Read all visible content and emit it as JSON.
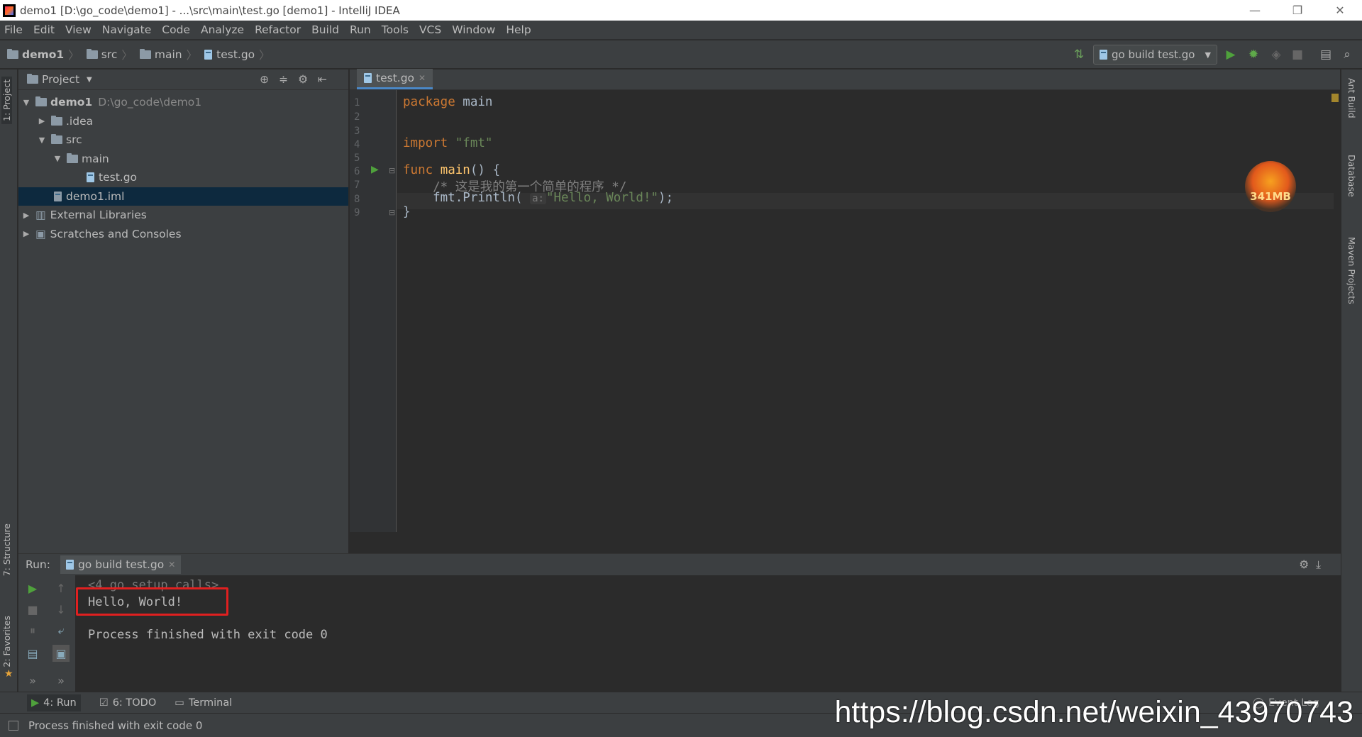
{
  "window": {
    "title": "demo1 [D:\\go_code\\demo1] - ...\\src\\main\\test.go [demo1] - IntelliJ IDEA"
  },
  "menu": [
    "File",
    "Edit",
    "View",
    "Navigate",
    "Code",
    "Analyze",
    "Refactor",
    "Build",
    "Run",
    "Tools",
    "VCS",
    "Window",
    "Help"
  ],
  "breadcrumbs": [
    "demo1",
    "src",
    "main",
    "test.go"
  ],
  "run_config": "go build test.go",
  "project": {
    "header": "Project",
    "tree": [
      {
        "label": "demo1",
        "extra": "D:\\go_code\\demo1"
      },
      {
        "label": ".idea"
      },
      {
        "label": "src"
      },
      {
        "label": "main"
      },
      {
        "label": "test.go"
      },
      {
        "label": "demo1.iml"
      },
      {
        "label": "External Libraries"
      },
      {
        "label": "Scratches and Consoles"
      }
    ]
  },
  "editor": {
    "tab": "test.go",
    "line_numbers": [
      "1",
      "2",
      "3",
      "4",
      "5",
      "6",
      "7",
      "8",
      "9"
    ],
    "code": {
      "l1_kw": "package",
      "l1_rest": " main",
      "l4_kw": "import",
      "l4_str": "\"fmt\"",
      "l6_kw": "func",
      "l6_fn": "main",
      "l6_rest": "() {",
      "l7": "    /* 这是我的第一个简单的程序 */",
      "l8_a": "    fmt.Println(",
      "l8_hint": "a:",
      "l8_str": "\"Hello, World!\"",
      "l8_end": ");",
      "l9": "}"
    },
    "memory": "341MB"
  },
  "run": {
    "label": "Run:",
    "tab": "go build test.go",
    "output": [
      "<4 go setup calls>",
      "Hello, World!",
      "Process finished with exit code 0"
    ]
  },
  "left_tabs": [
    "1: Project",
    "7: Structure",
    "2: Favorites"
  ],
  "right_tabs": [
    "Ant Build",
    "Database",
    "Maven Projects"
  ],
  "bottom_tabs": [
    "4: Run",
    "6: TODO",
    "Terminal"
  ],
  "status": "Process finished with exit code 0",
  "event_log": "Event Log",
  "watermark": "https://blog.csdn.net/weixin_43970743"
}
